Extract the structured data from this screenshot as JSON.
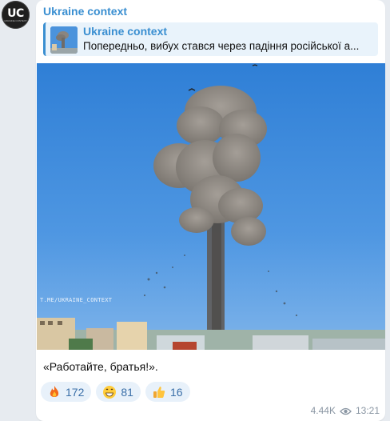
{
  "channel": {
    "name": "Ukraine context",
    "avatar_text": "UC",
    "avatar_subtext": "UKRAINE CONTEXT"
  },
  "reply": {
    "title": "Ukraine context",
    "text": "Попередньо, вибух стався через падіння російської а..."
  },
  "photo": {
    "watermark": "T.ME/UKRAINE_CONTEXT"
  },
  "message": {
    "caption": "«Работайте, братья!»."
  },
  "reactions": [
    {
      "icon": "fire-icon",
      "count": "172"
    },
    {
      "icon": "grin-icon",
      "count": "81"
    },
    {
      "icon": "thumbs-up-icon",
      "count": "16"
    }
  ],
  "meta": {
    "views": "4.44K",
    "time": "13:21"
  },
  "colors": {
    "accent": "#3a8fd1",
    "background": "#e7ebf0",
    "reaction_bg": "#e8f1fa"
  }
}
